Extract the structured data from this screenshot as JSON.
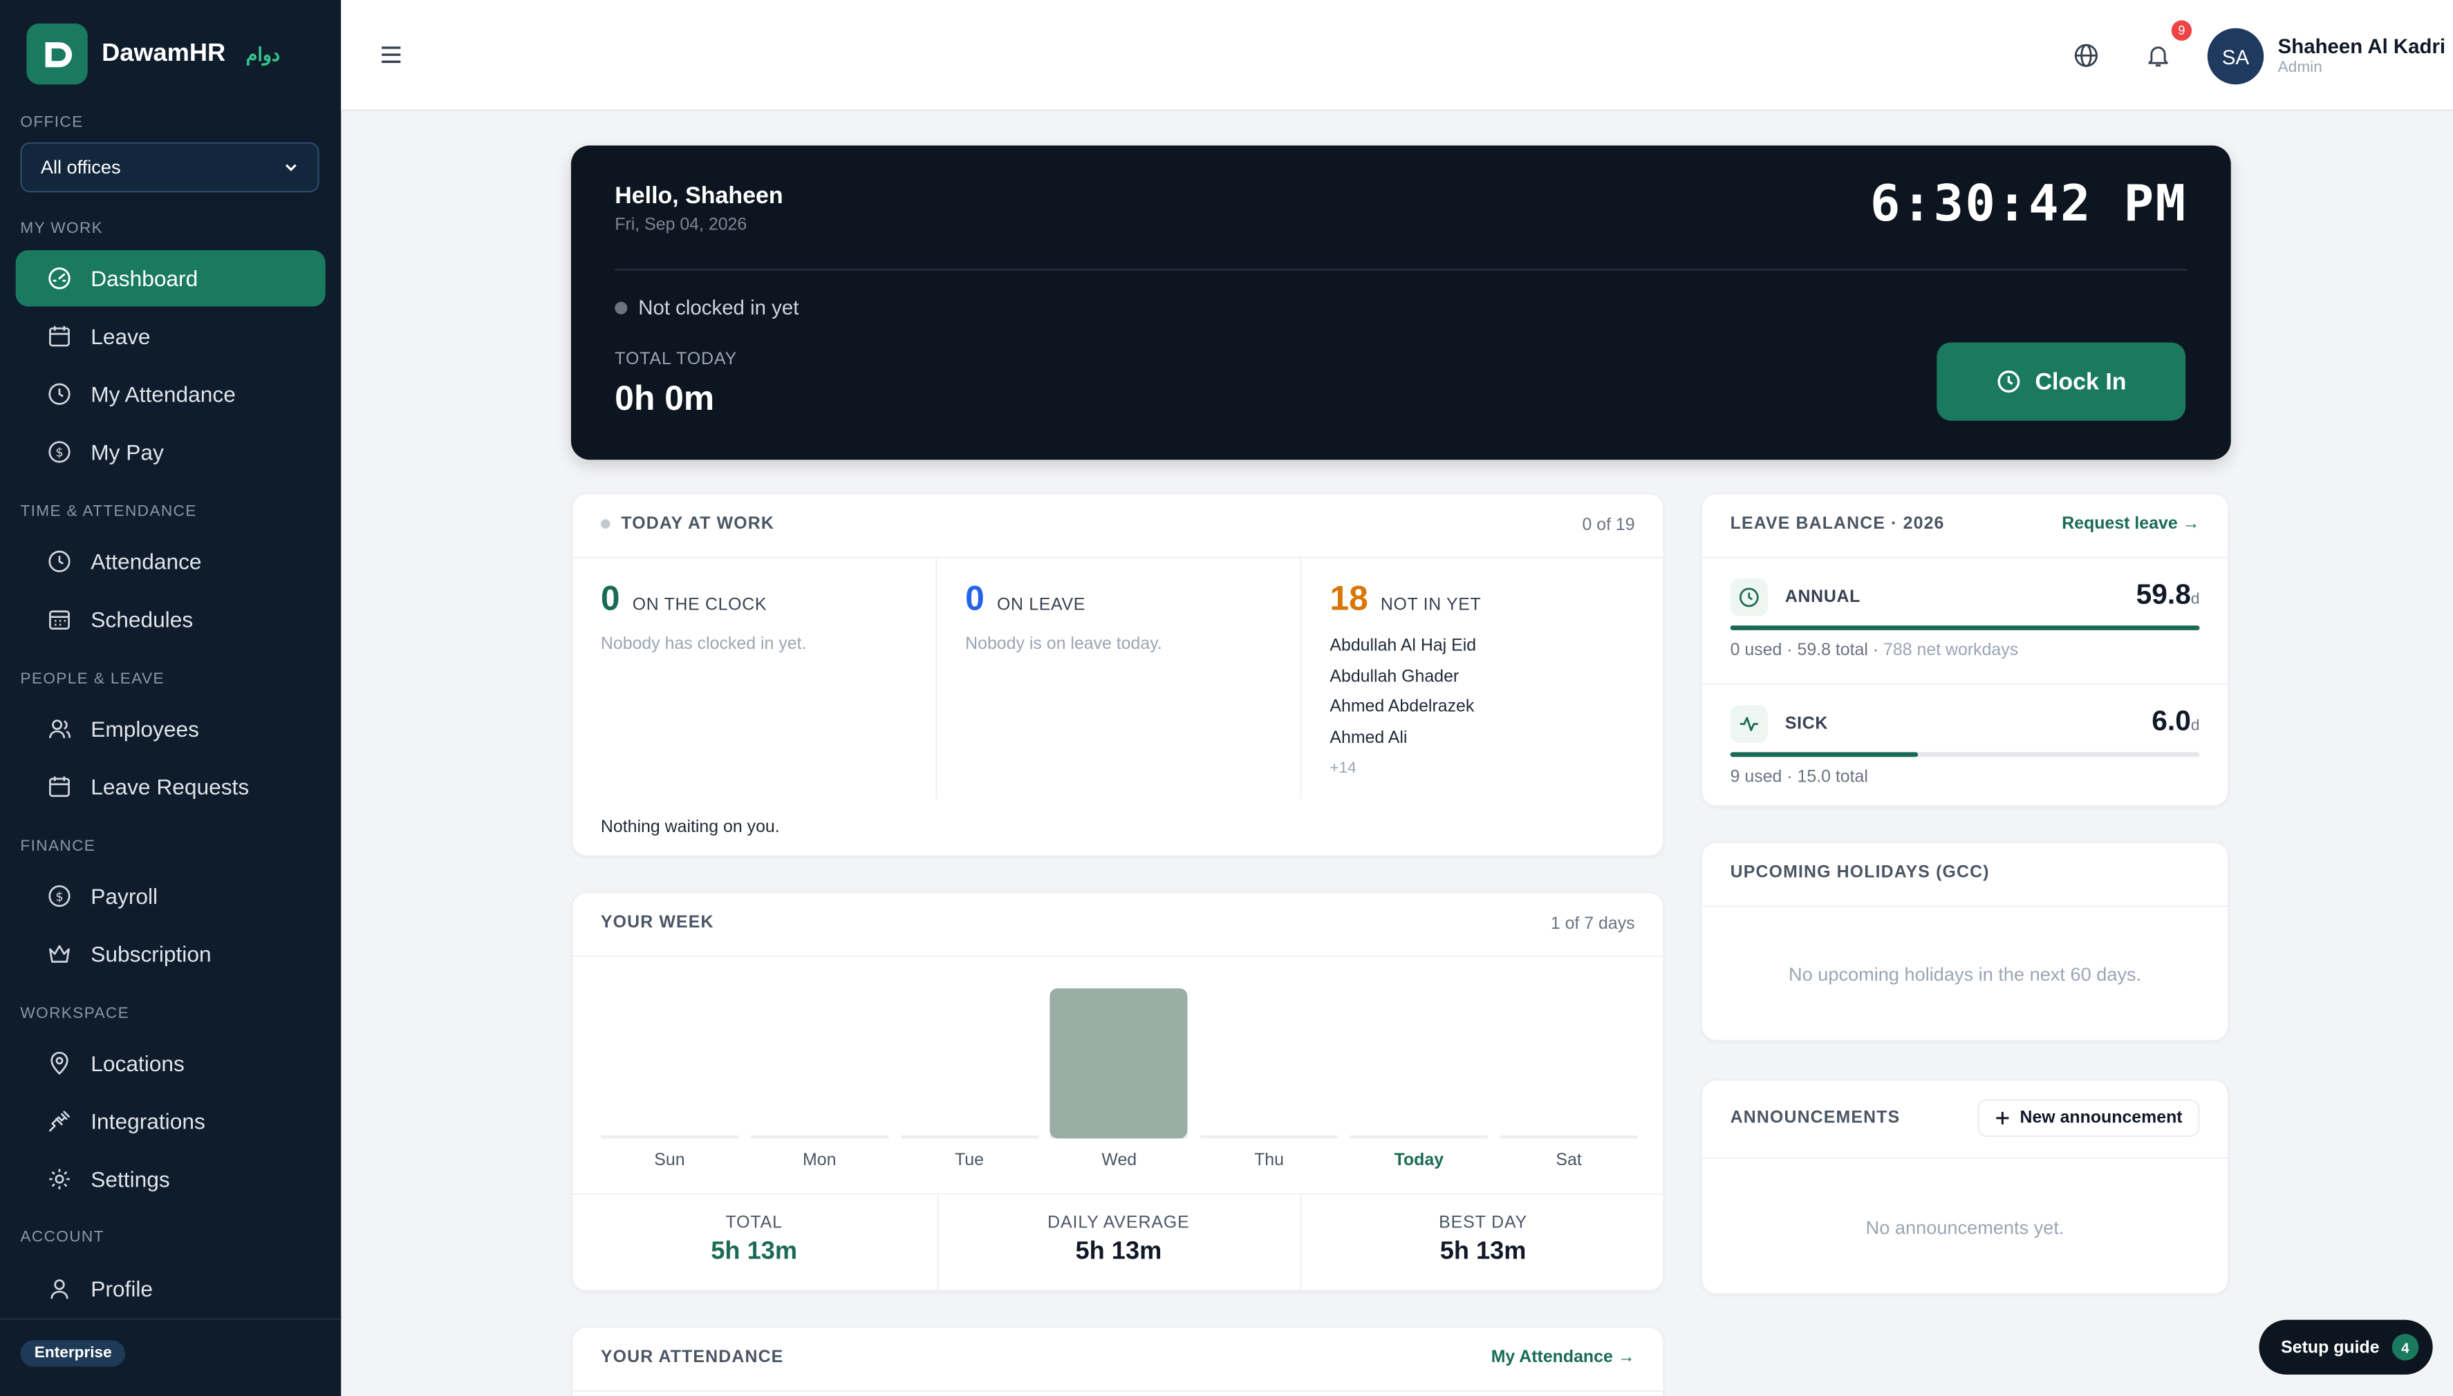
{
  "brand": {
    "name": "DawamHR",
    "arabic": "دوام"
  },
  "office": {
    "label": "OFFICE",
    "selected": "All offices"
  },
  "sidebar": {
    "sections": {
      "my_work": "MY WORK",
      "time_attendance": "TIME & ATTENDANCE",
      "people_leave": "PEOPLE & LEAVE",
      "finance": "FINANCE",
      "workspace": "WORKSPACE",
      "account": "ACCOUNT"
    },
    "items": {
      "dashboard": "Dashboard",
      "leave": "Leave",
      "my_attendance": "My Attendance",
      "my_pay": "My Pay",
      "attendance": "Attendance",
      "schedules": "Schedules",
      "employees": "Employees",
      "leave_requests": "Leave Requests",
      "payroll": "Payroll",
      "subscription": "Subscription",
      "locations": "Locations",
      "integrations": "Integrations",
      "settings": "Settings",
      "profile": "Profile"
    },
    "plan": "Enterprise"
  },
  "header": {
    "notifications": "9",
    "avatar_initials": "SA",
    "user_name": "Shaheen Al Kadri",
    "user_role": "Admin"
  },
  "hero": {
    "greeting": "Hello, Shaheen",
    "date": "Fri, Sep 04, 2026",
    "clock": "6:30:42 PM",
    "status": "Not clocked in yet",
    "total_label": "TOTAL TODAY",
    "total_value": "0h 0m",
    "clock_in": "Clock In"
  },
  "today_at_work": {
    "title": "TODAY AT WORK",
    "count": "0 of 19",
    "on_clock": {
      "value": "0",
      "label": "ON THE CLOCK",
      "sub": "Nobody has clocked in yet."
    },
    "on_leave": {
      "value": "0",
      "label": "ON LEAVE",
      "sub": "Nobody is on leave today."
    },
    "not_in": {
      "value": "18",
      "label": "NOT IN YET",
      "names": [
        "Abdullah Al Haj Eid",
        "Abdullah Ghader",
        "Ahmed Abdelrazek",
        "Ahmed Ali"
      ],
      "more": "+14"
    },
    "footer": "Nothing waiting on you."
  },
  "week": {
    "title": "YOUR WEEK",
    "count": "1 of 7 days",
    "days": [
      "Sun",
      "Mon",
      "Tue",
      "Wed",
      "Thu",
      "Today",
      "Sat"
    ],
    "hours": [
      0,
      0,
      0,
      5.22,
      0,
      0,
      0
    ],
    "total_label": "TOTAL",
    "total_value": "5h 13m",
    "avg_label": "DAILY AVERAGE",
    "avg_value": "5h 13m",
    "best_label": "BEST DAY",
    "best_value": "5h 13m"
  },
  "attendance": {
    "title": "YOUR ATTENDANCE",
    "link": "My Attendance →"
  },
  "leave_balance": {
    "title": "LEAVE BALANCE · 2026",
    "link": "Request leave →",
    "annual": {
      "name": "ANNUAL",
      "value": "59.8",
      "unit": "d",
      "used": "0 used · 59.8 total · ",
      "note": "788 net workdays",
      "fraction": 1.0
    },
    "sick": {
      "name": "SICK",
      "value": "6.0",
      "unit": "d",
      "used": "9 used · 15.0 total",
      "fraction": 0.4
    }
  },
  "holidays": {
    "title": "UPCOMING HOLIDAYS (GCC)",
    "empty": "No upcoming holidays in the next 60 days."
  },
  "announcements": {
    "title": "ANNOUNCEMENTS",
    "button": "New announcement",
    "empty": "No announcements yet."
  },
  "setup": {
    "label": "Setup guide",
    "count": "4"
  },
  "colors": {
    "accent": "#1a7a60",
    "sidebar": "#0f1c2b",
    "hero": "#0d1620",
    "orange": "#d97706",
    "blue": "#2563eb"
  }
}
